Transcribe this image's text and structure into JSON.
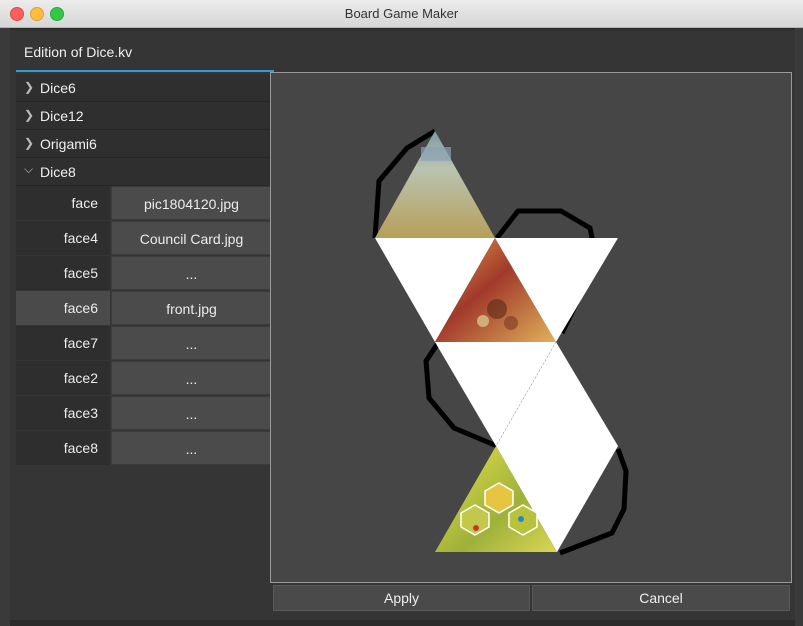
{
  "window": {
    "title": "Board Game Maker"
  },
  "dialog": {
    "title": "Edition of Dice.kv"
  },
  "tree": [
    {
      "label": "Dice6",
      "expanded": false
    },
    {
      "label": "Dice12",
      "expanded": false
    },
    {
      "label": "Origami6",
      "expanded": false
    },
    {
      "label": "Dice8",
      "expanded": true
    }
  ],
  "properties": [
    {
      "key": "face",
      "value": "pic1804120.jpg"
    },
    {
      "key": "face4",
      "value": "Council Card.jpg"
    },
    {
      "key": "face5",
      "value": "..."
    },
    {
      "key": "face6",
      "value": "front.jpg",
      "highlighted": true
    },
    {
      "key": "face7",
      "value": "..."
    },
    {
      "key": "face2",
      "value": "..."
    },
    {
      "key": "face3",
      "value": "..."
    },
    {
      "key": "face8",
      "value": "..."
    }
  ],
  "buttons": {
    "apply": "Apply",
    "cancel": "Cancel"
  },
  "icons": {
    "collapsed": "chevron-right-icon",
    "expanded": "chevron-down-icon"
  }
}
